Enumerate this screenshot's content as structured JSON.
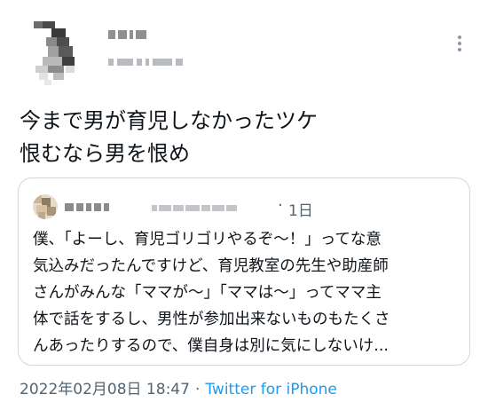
{
  "tweet": {
    "text": "今まで男が育児しなかったツケ\n恨むなら男を恨め"
  },
  "quote": {
    "time": "1日",
    "separator": "·",
    "text": "僕、「よーし、育児ゴリゴリやるぞ～！」ってな意\n気込みだったんですけど、育児教室の先生や助産師\nさんがみんな「ママが～」「ママは～」ってママ主\n体で話をするし、男性が参加出来ないものもたくさ\nんあったりするので、僕自身は別に気にしないけ..."
  },
  "footer": {
    "datetime": "2022年02月08日 18:47",
    "separator": "·",
    "source": "Twitter for iPhone"
  },
  "icons": {
    "more": "more-vertical-icon"
  },
  "colors": {
    "text": "#0f1419",
    "secondary": "#536471",
    "link": "#1d9bf0",
    "border": "#cfd9de"
  }
}
